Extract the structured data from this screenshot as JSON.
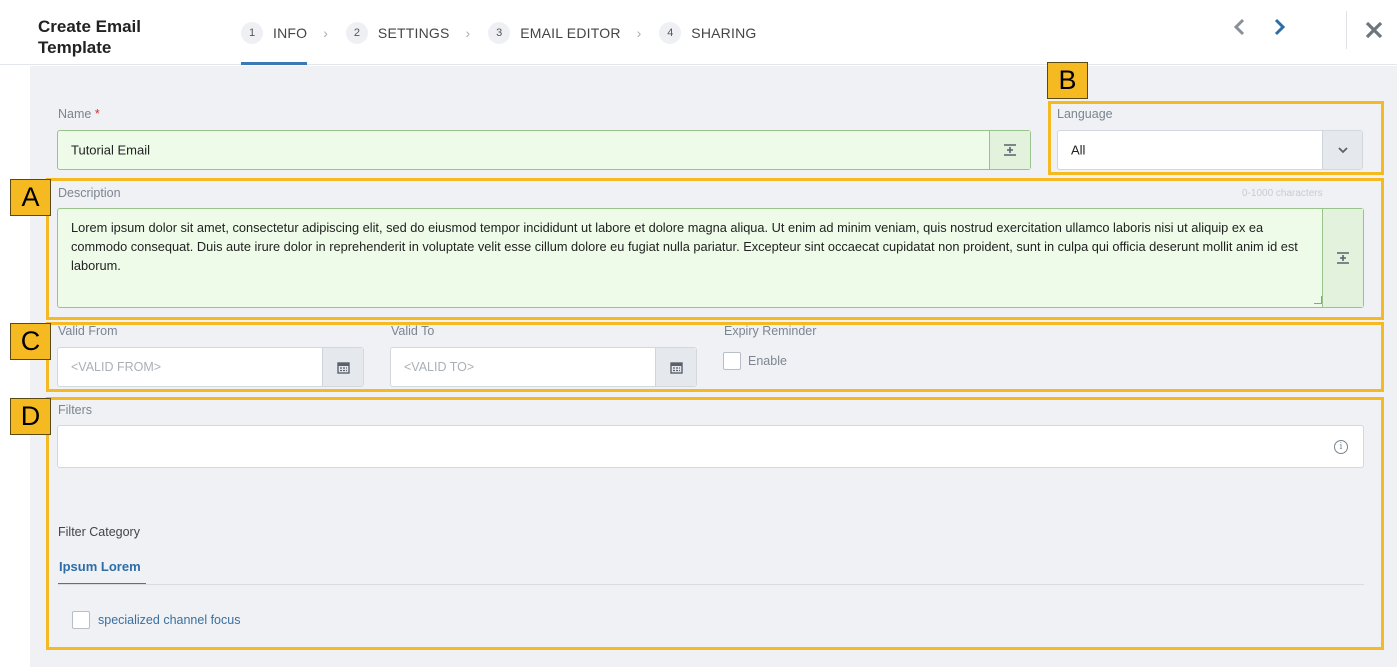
{
  "header": {
    "title": "Create Email Template",
    "steps": [
      {
        "num": "1",
        "label": "INFO"
      },
      {
        "num": "2",
        "label": "SETTINGS"
      },
      {
        "num": "3",
        "label": "EMAIL EDITOR"
      },
      {
        "num": "4",
        "label": "SHARING"
      }
    ],
    "active_step": "INFO",
    "step_separator": "›",
    "prev_icon": "‹",
    "next_icon": "›",
    "close_icon": "✕"
  },
  "form": {
    "name": {
      "label": "Name",
      "required_mark": "*",
      "value": "Tutorial Email",
      "addon_icon": "⌶"
    },
    "language": {
      "label": "Language",
      "value": "All",
      "dropdown_icon": "⌄"
    },
    "description": {
      "label": "Description",
      "counter": "0-1000 characters",
      "value": "Lorem ipsum dolor sit amet, consectetur adipiscing elit, sed do eiusmod tempor incididunt ut labore et dolore magna aliqua. Ut enim ad minim veniam, quis nostrud exercitation ullamco laboris nisi ut aliquip ex ea commodo consequat. Duis aute irure dolor in reprehenderit in voluptate velit esse cillum dolore eu fugiat nulla pariatur. Excepteur sint occaecat cupidatat non proident, sunt in culpa qui officia deserunt mollit anim id est laborum.",
      "addon_icon": "⌶"
    },
    "valid_from": {
      "label": "Valid From",
      "placeholder": "<VALID FROM>",
      "icon": "calendar-icon"
    },
    "valid_to": {
      "label": "Valid To",
      "placeholder": "<VALID TO>",
      "icon": "calendar-icon"
    },
    "expiry_reminder": {
      "label": "Expiry Reminder",
      "checkbox_label": "Enable",
      "checked": false
    },
    "filters": {
      "label": "Filters",
      "value": "",
      "info_icon": "i"
    },
    "filter_category": {
      "label": "Filter Category",
      "tabs": [
        "Ipsum Lorem"
      ],
      "options": [
        {
          "label": "specialized channel focus",
          "checked": false
        }
      ]
    }
  },
  "annotations": {
    "A": "A",
    "B": "B",
    "C": "C",
    "D": "D",
    "color": "#f5b921"
  },
  "colors": {
    "accent": "#3b78b5",
    "valid_field_bg": "#eefbe9",
    "required": "#d0302b",
    "page_bg": "#eff1f5"
  }
}
